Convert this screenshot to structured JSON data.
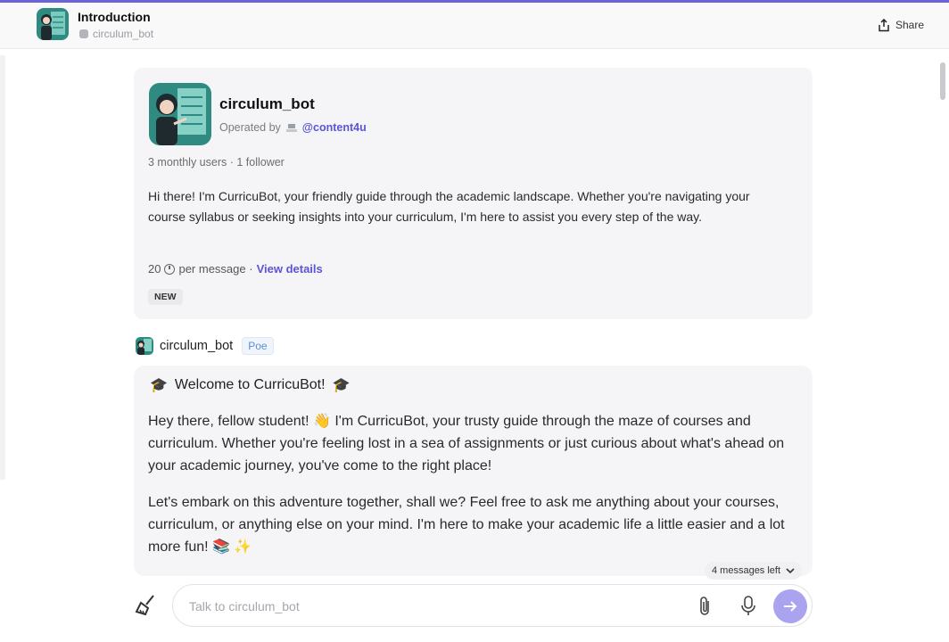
{
  "header": {
    "title": "Introduction",
    "bot_handle": "circulum_bot",
    "share_label": "Share"
  },
  "intro_card": {
    "bot_name": "circulum_bot",
    "operated_prefix": "Operated by",
    "operator_handle": "@content4u",
    "stats": "3 monthly users · 1 follower",
    "description": "Hi there! I'm CurricuBot, your friendly guide through the academic landscape. Whether you're navigating your course syllabus or seeking insights into your curriculum, I'm here to assist you every step of the way.",
    "price_value": "20",
    "price_suffix": "per message ·",
    "view_details": "View details",
    "badge": "NEW"
  },
  "message": {
    "sender": "circulum_bot",
    "sender_tag": "Poe",
    "welcome_emoji": "🎓",
    "welcome_text": "Welcome to CurricuBot!",
    "paragraph1": "Hey there, fellow student! 👋 I'm CurricuBot, your trusty guide through the maze of courses and curriculum. Whether you're feeling lost in a sea of assignments or just curious about what's ahead on your academic journey, you've come to the right place!",
    "paragraph2": "Let's embark on this adventure together, shall we? Feel free to ask me anything about your courses, curriculum, or anything else on your mind. I'm here to make your academic life a little easier and a lot more fun! 📚 ✨"
  },
  "composer": {
    "messages_left": "4 messages left",
    "placeholder": "Talk to circulum_bot"
  },
  "colors": {
    "accent": "#6b63d8",
    "link": "#5b54d6",
    "send_button": "#a9a3f0",
    "card_bg": "#f5f5f7",
    "avatar_teal": "#3f9f95"
  }
}
